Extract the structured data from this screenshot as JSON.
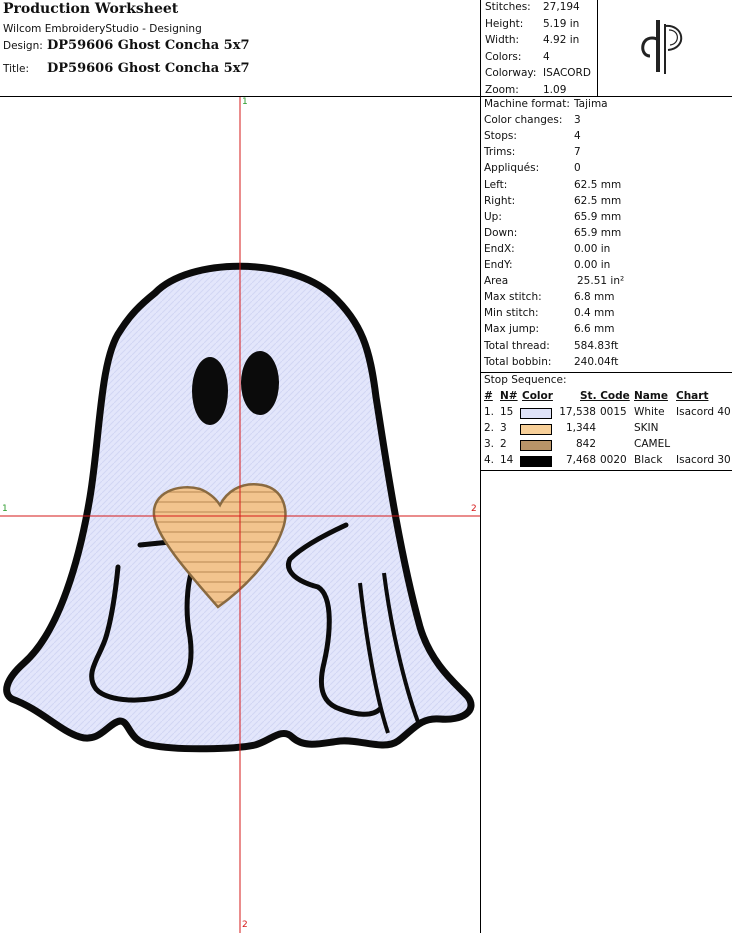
{
  "header": {
    "title": "Production Worksheet",
    "software": "Wilcom EmbroideryStudio - Designing",
    "design_label": "Design:",
    "design_value": "DP59606 Ghost Concha 5x7",
    "title_label": "Title:",
    "title_value": "DP59606 Ghost Concha 5x7"
  },
  "summary": [
    {
      "label": "Stitches:",
      "value": "27,194"
    },
    {
      "label": "Height:",
      "value": "5.19 in"
    },
    {
      "label": "Width:",
      "value": "4.92 in"
    },
    {
      "label": "Colors:",
      "value": "4"
    },
    {
      "label": "Colorway:",
      "value": "ISACORD"
    },
    {
      "label": "Zoom:",
      "value": "1.09"
    }
  ],
  "details": [
    {
      "label": "Machine format:",
      "value": "Tajima"
    },
    {
      "label": "Color changes:",
      "value": "3"
    },
    {
      "label": "Stops:",
      "value": "4"
    },
    {
      "label": "Trims:",
      "value": "7"
    },
    {
      "label": "Appliqués:",
      "value": "0"
    },
    {
      "label": "Left:",
      "value": "62.5 mm"
    },
    {
      "label": "Right:",
      "value": "62.5 mm"
    },
    {
      "label": "Up:",
      "value": "65.9 mm"
    },
    {
      "label": "Down:",
      "value": "65.9 mm"
    },
    {
      "label": "EndX:",
      "value": "0.00 in"
    },
    {
      "label": "EndY:",
      "value": "0.00 in"
    },
    {
      "label": "Area",
      "value": "25.51 in²"
    },
    {
      "label": "Max stitch:",
      "value": "6.8 mm"
    },
    {
      "label": "Min stitch:",
      "value": "0.4 mm"
    },
    {
      "label": "Max jump:",
      "value": "6.6 mm"
    },
    {
      "label": "Total thread:",
      "value": "584.83ft"
    },
    {
      "label": "Total bobbin:",
      "value": "240.04ft"
    }
  ],
  "stops": {
    "title": "Stop Sequence:",
    "headers": {
      "num": "#",
      "n": "N#",
      "color": "Color",
      "stcode": "St. Code",
      "name": "Name",
      "chart": "Chart"
    },
    "rows": [
      {
        "num": "1.",
        "n": "15",
        "swatch": "#dfe3f8",
        "stitches": "17,538",
        "code": "0015",
        "name": "White",
        "chart": "Isacord 40"
      },
      {
        "num": "2.",
        "n": "3",
        "swatch": "#f7cf98",
        "stitches": "1,344",
        "code": "",
        "name": "SKIN",
        "chart": ""
      },
      {
        "num": "3.",
        "n": "2",
        "swatch": "#b89468",
        "stitches": "842",
        "code": "",
        "name": "CAMEL",
        "chart": ""
      },
      {
        "num": "4.",
        "n": "14",
        "swatch": "#000000",
        "stitches": "7,468",
        "code": "0020",
        "name": "Black",
        "chart": "Isacord 30"
      }
    ]
  },
  "crosshair": {
    "top": "1",
    "left": "1",
    "right": "2",
    "bottom": "2"
  },
  "colors": {
    "ghost_fill": "#e3e6fb",
    "outline": "#0b0b0b",
    "heart_fill": "#f2c48e",
    "heart_stripe": "#c99a62",
    "crosshair": "#d61a1a"
  }
}
